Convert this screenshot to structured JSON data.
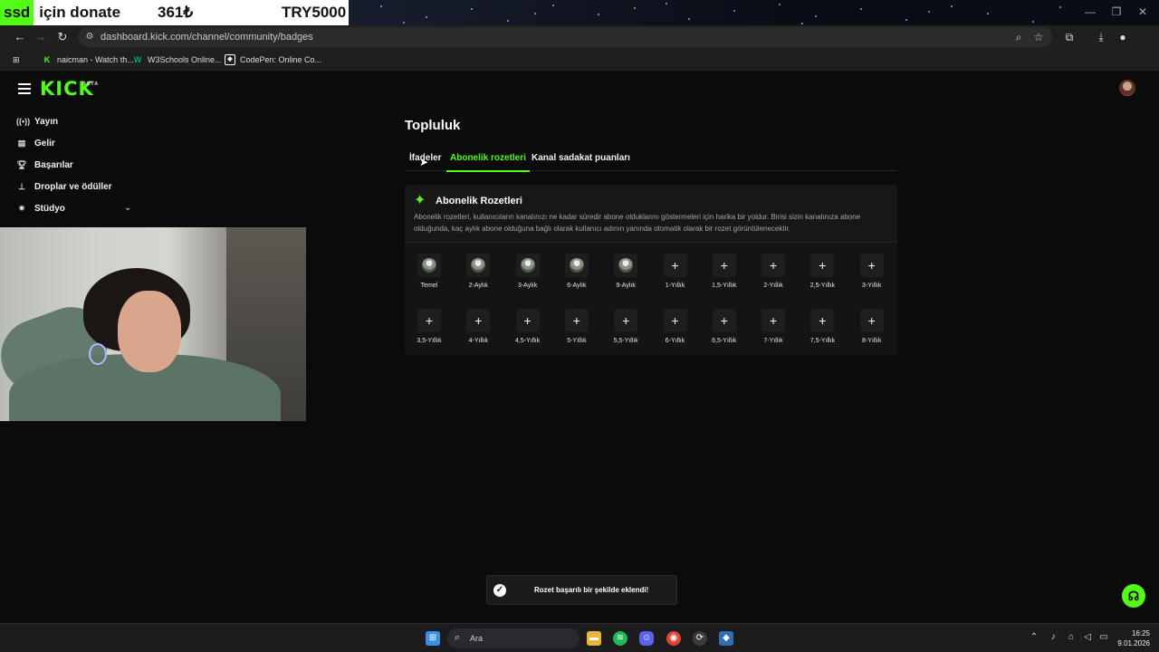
{
  "overlay": {
    "donate_ssd": "ssd",
    "donate_text": "için donate",
    "donate_amount": "361₺",
    "donate_currency": "TRY5000"
  },
  "browser": {
    "url": "dashboard.kick.com/channel/community/badges",
    "bookmarks": [
      {
        "label": "naicman - Watch th...",
        "icon": "kick-favicon",
        "color": "#53fc18"
      },
      {
        "label": "W3Schools Online...",
        "icon": "w3schools-favicon",
        "color": "#04aa6d"
      },
      {
        "label": "CodePen: Online Co...",
        "icon": "codepen-favicon",
        "color": "#ffffff"
      }
    ]
  },
  "app": {
    "logo": "KICK",
    "logo_sup": "BETA",
    "accent": "#53fc18",
    "sidebar": [
      {
        "label": "Yayın",
        "icon": "broadcast-icon"
      },
      {
        "label": "Gelir",
        "icon": "revenue-icon"
      },
      {
        "label": "Başarılar",
        "icon": "trophy-icon"
      },
      {
        "label": "Droplar ve ödüller",
        "icon": "gift-icon"
      },
      {
        "label": "Stüdyo",
        "icon": "studio-icon"
      }
    ],
    "page_title": "Topluluk",
    "tabs": [
      {
        "label": "İfadeler",
        "active": false
      },
      {
        "label": "Abonelik rozetleri",
        "active": true
      },
      {
        "label": "Kanal sadakat puanları",
        "active": false
      }
    ],
    "card": {
      "title": "Abonelik Rozetleri",
      "description": "Abonelik rozetleri, kullanıcıların kanalınızı ne kadar süredir abone olduklarını göstermeleri için harika bir yoldur. Birisi sizin kanalınıza abone olduğunda, kaç aylık abone olduğuna bağlı olarak kullanıcı adının yanında otomatik olarak bir rozet görüntülenecektir."
    },
    "badges": [
      {
        "label": "Temel",
        "filled": true
      },
      {
        "label": "2-Aylık",
        "filled": true
      },
      {
        "label": "3-Aylık",
        "filled": true
      },
      {
        "label": "6-Aylık",
        "filled": true
      },
      {
        "label": "9-Aylık",
        "filled": true
      },
      {
        "label": "1-Yıllık",
        "filled": false
      },
      {
        "label": "1,5-Yıllık",
        "filled": false
      },
      {
        "label": "2-Yıllık",
        "filled": false
      },
      {
        "label": "2,5-Yıllık",
        "filled": false
      },
      {
        "label": "3-Yıllık",
        "filled": false
      },
      {
        "label": "3,5-Yıllık",
        "filled": false
      },
      {
        "label": "4-Yıllık",
        "filled": false
      },
      {
        "label": "4,5-Yıllık",
        "filled": false
      },
      {
        "label": "5-Yıllık",
        "filled": false
      },
      {
        "label": "5,5-Yıllık",
        "filled": false
      },
      {
        "label": "6-Yıllık",
        "filled": false
      },
      {
        "label": "6,5-Yıllık",
        "filled": false
      },
      {
        "label": "7-Yıllık",
        "filled": false
      },
      {
        "label": "7,5-Yıllık",
        "filled": false
      },
      {
        "label": "8-Yıllık",
        "filled": false
      }
    ],
    "toast": "Rozet başarılı bir şekilde eklendi!"
  },
  "taskbar": {
    "search_placeholder": "Ara",
    "time": "16:25",
    "date": "9.01.2026"
  }
}
